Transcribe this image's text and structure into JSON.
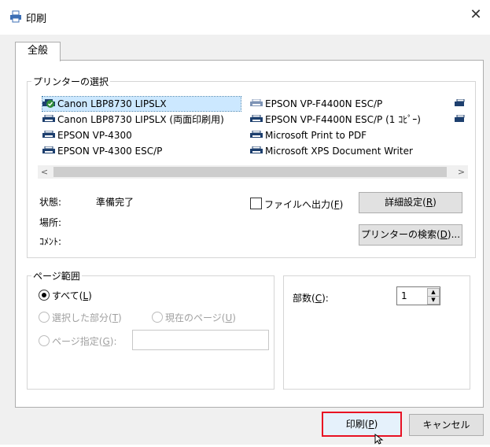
{
  "window": {
    "title": "印刷",
    "close_label": "✕"
  },
  "tabs": [
    {
      "label": "全般"
    }
  ],
  "printer_group": {
    "legend": "プリンターの選択",
    "printers": [
      {
        "name": "Canon LBP8730 LIPSLX",
        "selected": true,
        "default": true
      },
      {
        "name": "Canon LBP8730 LIPSLX (両面印刷用)"
      },
      {
        "name": "EPSON VP-4300"
      },
      {
        "name": "EPSON VP-4300 ESC/P"
      },
      {
        "name": "EPSON VP-F4400N ESC/P"
      },
      {
        "name": "EPSON VP-F4400N ESC/P (1 ｺﾋﾟｰ)"
      },
      {
        "name": "Microsoft Print to PDF"
      },
      {
        "name": "Microsoft XPS Document Writer"
      }
    ],
    "scroll_left": "<",
    "scroll_right": ">",
    "status_label": "状態:",
    "status_value": "準備完了",
    "location_label": "場所:",
    "comment_label": "ｺﾒﾝﾄ:",
    "print_to_file_label": "ファイルへ出力(",
    "print_to_file_key": "F",
    "print_to_file_close": ")",
    "details_button": {
      "label": "詳細設定(",
      "key": "R",
      "close": ")"
    },
    "find_button": {
      "label": "プリンターの検索(",
      "key": "D",
      "close": ")..."
    }
  },
  "page_range": {
    "legend": "ページ範囲",
    "all": {
      "label": "すべて(",
      "key": "L",
      "close": ")"
    },
    "selection": {
      "label": "選択した部分(",
      "key": "T",
      "close": ")"
    },
    "current": {
      "label": "現在のページ(",
      "key": "U",
      "close": ")"
    },
    "pages": {
      "label": "ページ指定(",
      "key": "G",
      "close": "):"
    }
  },
  "copies": {
    "label": "部数(",
    "key": "C",
    "close": "):",
    "value": "1"
  },
  "buttons": {
    "print": {
      "label": "印刷(",
      "key": "P",
      "close": ")"
    },
    "cancel": {
      "label": "キャンセル"
    }
  },
  "colors": {
    "highlight_border": "#e81123",
    "selection_bg": "#cce8ff",
    "panel_border": "#adadad"
  }
}
